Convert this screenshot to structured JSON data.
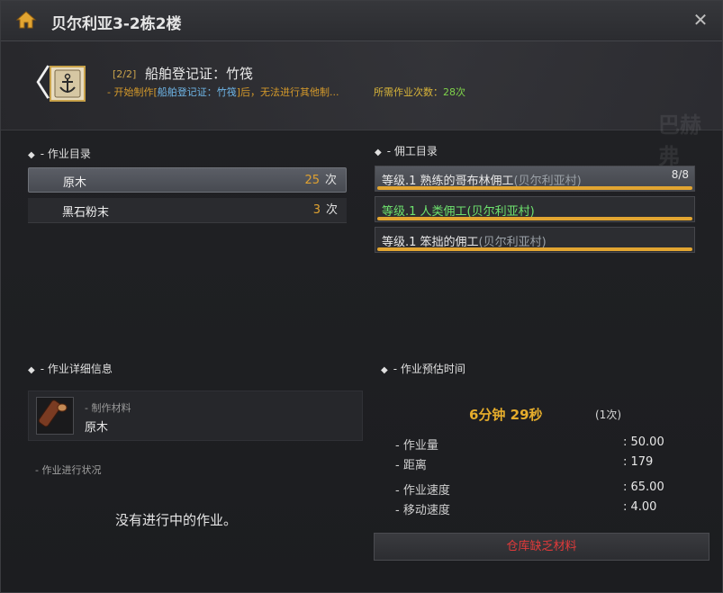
{
  "window": {
    "title": "贝尔利亚3-2栋2楼"
  },
  "header": {
    "step": "[2/2]",
    "craft_name": "船舶登记证：竹筏",
    "warning_prefix": "- 开始制作[",
    "warning_highlight": "船舶登记证：竹筏",
    "warning_suffix": "]后，无法进行其他制...",
    "required_label": "所需作业次数：",
    "required_value": "28次",
    "watermark": "巴赫弗"
  },
  "work_list": {
    "title": "- 作业目录",
    "items": [
      {
        "name": "原木",
        "count": "25",
        "unit": "次"
      },
      {
        "name": "黑石粉末",
        "count": "3",
        "unit": "次"
      }
    ]
  },
  "worker_list": {
    "title": "- 佣工目录",
    "items": [
      {
        "level": "等级.1 熟练的哥布林佣工",
        "town": "(贝尔利亚村)",
        "capacity": "8/8",
        "green": false
      },
      {
        "level": "等级.1 人类佣工",
        "town": "(贝尔利亚村)",
        "capacity": "",
        "green": true
      },
      {
        "level": "等级.1 笨拙的佣工",
        "town": "(贝尔利亚村)",
        "capacity": "",
        "green": false
      }
    ]
  },
  "detail": {
    "title": "- 作业详细信息",
    "material_label": "- 制作材料",
    "material_name": "原木",
    "status_label": "- 作业进行状况",
    "no_work": "没有进行中的作业。"
  },
  "estimate": {
    "title": "- 作业预估时间",
    "time": "6分钟 29秒",
    "count": "(1次)",
    "stats": [
      {
        "label": "- 作业量",
        "value": ": 50.00"
      },
      {
        "label": "- 距离",
        "value": ": 179"
      },
      {
        "label": "- 作业速度",
        "value": ": 65.00"
      },
      {
        "label": "- 移动速度",
        "value": ": 4.00"
      }
    ]
  },
  "action": {
    "label": "仓库缺乏材料"
  },
  "colors": {
    "accent": "#e2a531",
    "warn": "#e23a3a",
    "green": "#6ee36e"
  }
}
